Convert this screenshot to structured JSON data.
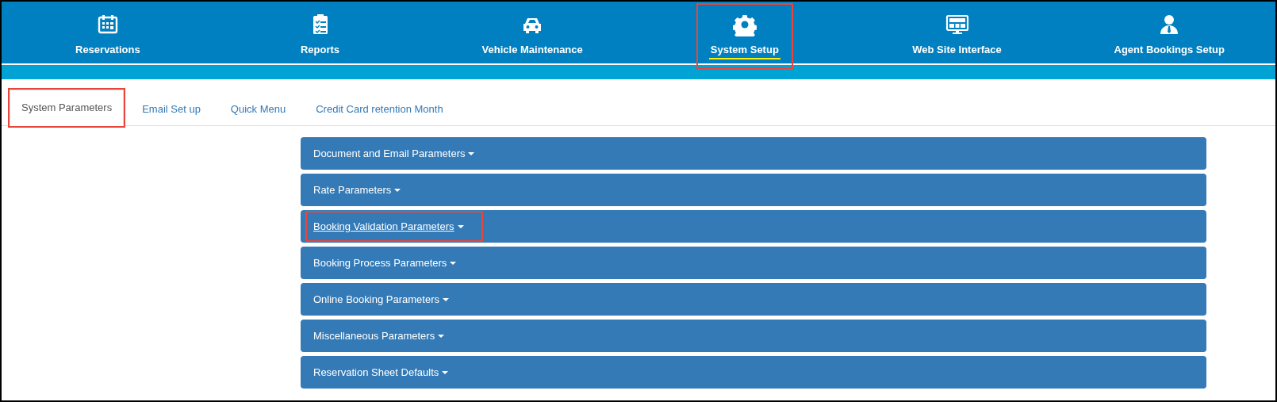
{
  "nav_items": [
    {
      "label": "Reservations",
      "selected": false,
      "highlighted": false
    },
    {
      "label": "Reports",
      "selected": false,
      "highlighted": false
    },
    {
      "label": "Vehicle Maintenance",
      "selected": false,
      "highlighted": false
    },
    {
      "label": "System Setup",
      "selected": true,
      "highlighted": true
    },
    {
      "label": "Web Site Interface",
      "selected": false,
      "highlighted": false
    },
    {
      "label": "Agent Bookings Setup",
      "selected": false,
      "highlighted": false
    }
  ],
  "tabs": [
    {
      "label": "System Parameters",
      "selected": true,
      "highlighted": true
    },
    {
      "label": "Email Set up",
      "selected": false,
      "highlighted": false
    },
    {
      "label": "Quick Menu",
      "selected": false,
      "highlighted": false
    },
    {
      "label": "Credit Card retention Month",
      "selected": false,
      "highlighted": false
    }
  ],
  "panels": [
    {
      "title": "Document and Email Parameters",
      "hovered": false,
      "highlighted": false
    },
    {
      "title": "Rate Parameters",
      "hovered": false,
      "highlighted": false
    },
    {
      "title": "Booking Validation Parameters",
      "hovered": true,
      "highlighted": true
    },
    {
      "title": "Booking Process Parameters",
      "hovered": false,
      "highlighted": false
    },
    {
      "title": "Online Booking Parameters",
      "hovered": false,
      "highlighted": false
    },
    {
      "title": "Miscellaneous Parameters",
      "hovered": false,
      "highlighted": false
    },
    {
      "title": "Reservation Sheet Defaults",
      "hovered": false,
      "highlighted": false
    }
  ]
}
